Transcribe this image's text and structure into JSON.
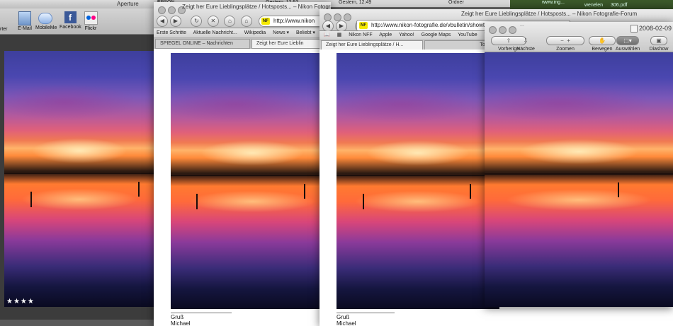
{
  "desktop": {
    "top_texts": [
      "EPSON",
      "Gestern, 12:52",
      "Gestern, 12:49",
      "Ordner"
    ],
    "top_right": [
      "www.ing...",
      "wenelen",
      "306.pdf"
    ]
  },
  "aperture": {
    "title": "Aperture",
    "toolbar_left_fragment": "rter",
    "toolbar_items": [
      {
        "label": "E-Mail",
        "icon": "email-icon"
      },
      {
        "label": "MobileMe",
        "icon": "mobileme-icon"
      },
      {
        "label": "Facebook",
        "icon": "facebook-icon"
      },
      {
        "label": "Flickr",
        "icon": "flickr-icon"
      }
    ],
    "rating": "★★★★"
  },
  "safari1": {
    "title": "Zeigt her Eure Lieblingsplätze / Hotsposts... – Nikon Fotografie-Forum",
    "address": "http://www.nikon",
    "bookmarks": [
      "Erste Schritte",
      "Aktuelle Nachricht... ",
      "Wikipedia",
      "News ▾",
      "Beliebt ▾"
    ],
    "tabs": [
      "SPIEGEL ONLINE – Nachrichten",
      "Zeigt her Eure Lieblin"
    ],
    "post_greeting": "Gruß",
    "post_name": "Michael"
  },
  "safari2": {
    "title": "Zeigt her Eure Lieblingsplätze / Hotsposts... – Nikon Fotografie-Forum",
    "address": "http://www.nikon-fotografie.de/vbulletin/showthr",
    "bookmarks": [
      "Nikon NFF",
      "Apple",
      "Yahoo!",
      "Google Maps",
      "YouTube",
      "W"
    ],
    "tabs": [
      "Zeigt her Eure Lieblingsplätze / H...",
      "Top Sites"
    ],
    "post_greeting": "Gruß",
    "post_name": "Michael"
  },
  "preview": {
    "title_fragment": "...",
    "date": "2008-02-09",
    "toolbar": [
      {
        "label": "Vorherige",
        "icon": "arrow-up-icon"
      },
      {
        "label": "Nächste",
        "icon": "arrow-down-icon"
      },
      {
        "label": "Zoomen",
        "icon": "zoom-icon"
      },
      {
        "label": "Bewegen",
        "icon": "hand-icon"
      },
      {
        "label": "Auswählen",
        "icon": "select-icon"
      },
      {
        "label": "Diashow",
        "icon": "slideshow-icon"
      }
    ]
  }
}
